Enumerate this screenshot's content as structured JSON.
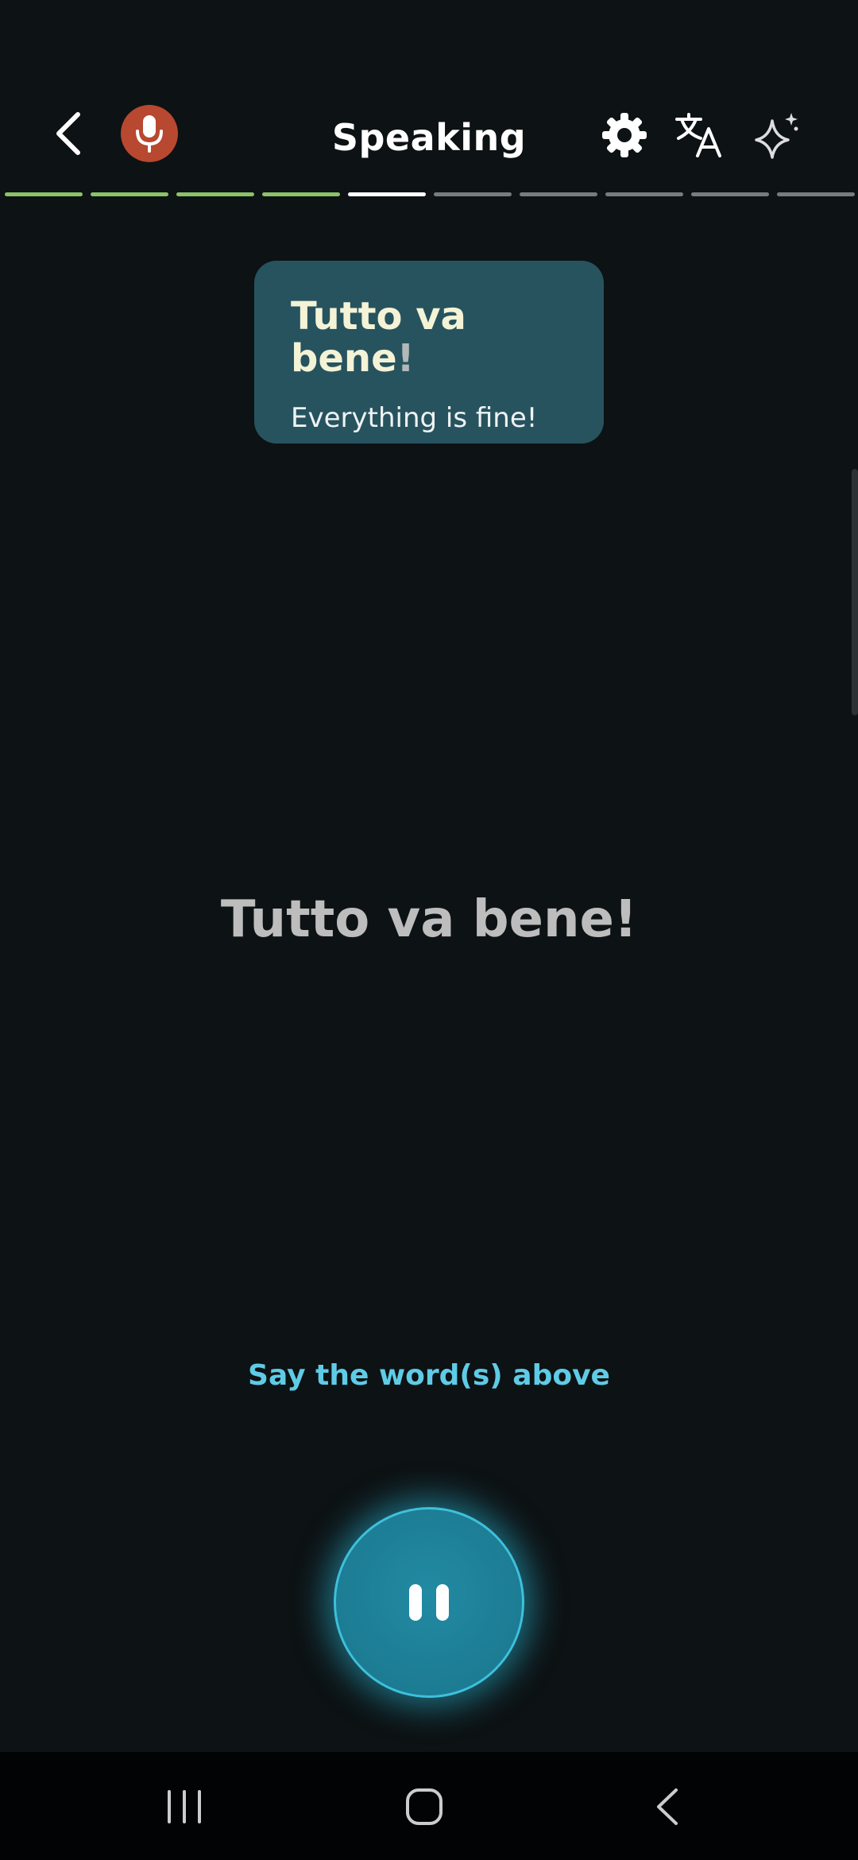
{
  "header": {
    "title": "Speaking",
    "back_icon": "chevron-left-icon",
    "mic_icon": "microphone-icon",
    "settings_icon": "gear-icon",
    "translate_icon": "translate-icon",
    "ai_icon": "sparkle-icon"
  },
  "progress": {
    "total": 10,
    "completed": 4,
    "current": 5,
    "colors": {
      "done": "#8bc26a",
      "current": "#ffffff",
      "pending": "#777c7e"
    }
  },
  "card": {
    "phrase": "Tutto va bene",
    "phrase_punctuation": "!",
    "translation": "Everything is fine!"
  },
  "prompt": {
    "phrase": "Tutto va bene!",
    "instruction": "Say the word(s) above"
  },
  "controls": {
    "record_state": "pause-icon"
  },
  "navbar": {
    "recent_icon": "recent-apps-icon",
    "home_icon": "home-icon",
    "back_icon": "back-icon"
  },
  "colors": {
    "background": "#0d1214",
    "card": "#27535f",
    "accent": "#5fcbe6",
    "mic_badge": "#b8482f"
  }
}
